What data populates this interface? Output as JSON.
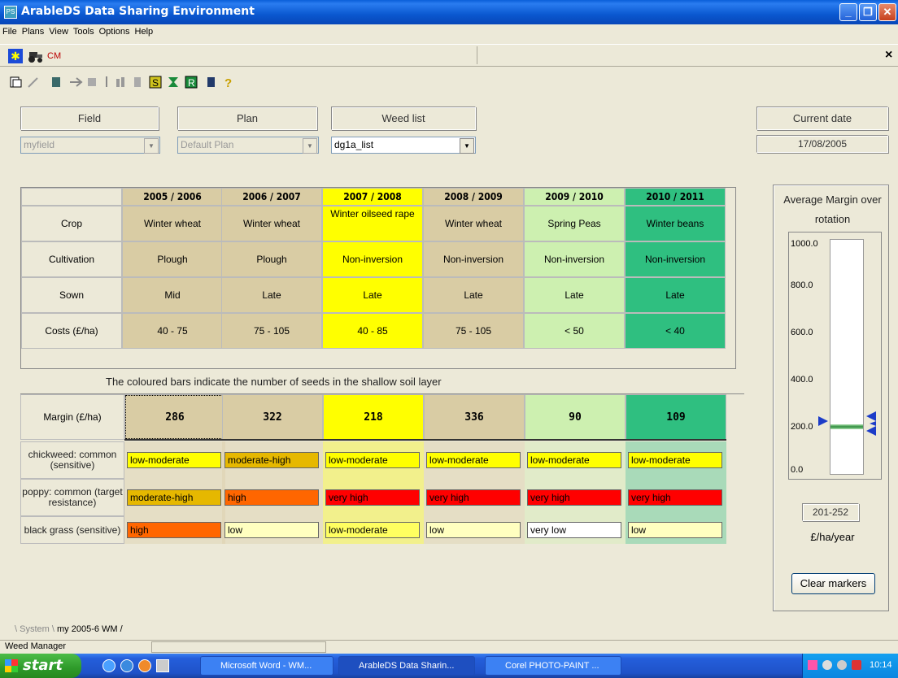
{
  "window": {
    "title": "ArableDS Data Sharing Environment",
    "icon_text": "PS"
  },
  "menu": [
    "File",
    "Plans",
    "View",
    "Tools",
    "Options",
    "Help"
  ],
  "cm_label": "CM",
  "close_x": "×",
  "fields": {
    "field": {
      "label": "Field",
      "value": "myfield"
    },
    "plan": {
      "label": "Plan",
      "value": "Default Plan"
    },
    "weed": {
      "label": "Weed list",
      "value": "dg1a_list"
    },
    "date": {
      "label": "Current date",
      "value": "17/08/2005"
    }
  },
  "plan_table": {
    "years": [
      "2005 / 2006",
      "2006 / 2007",
      "2007 / 2008",
      "2008 / 2009",
      "2009 / 2010",
      "2010 / 2011"
    ],
    "row_labels": [
      "Crop",
      "Cultivation",
      "Sown",
      "Costs  (£/ha)"
    ],
    "crop": [
      "Winter wheat",
      "Winter wheat",
      "Winter oilseed rape",
      "Winter wheat",
      "Spring Peas",
      "Winter beans"
    ],
    "cultivation": [
      "Plough",
      "Plough",
      "Non-inversion",
      "Non-inversion",
      "Non-inversion",
      "Non-inversion"
    ],
    "sown": [
      "Mid",
      "Late",
      "Late",
      "Late",
      "Late",
      "Late"
    ],
    "costs": [
      "40 - 75",
      "75 - 105",
      "40 - 85",
      "75 - 105",
      "< 50",
      "< 40"
    ]
  },
  "seed_caption": "The coloured bars indicate the number of seeds in the shallow soil layer",
  "margin": {
    "label": "Margin (£/ha)",
    "values": [
      "286",
      "322",
      "218",
      "336",
      "90",
      "109"
    ]
  },
  "weeds": [
    {
      "name": "chickweed: common (sensitive)",
      "levels": [
        "low-moderate",
        "moderate-high",
        "low-moderate",
        "low-moderate",
        "low-moderate",
        "low-moderate"
      ],
      "colors": [
        "#ffff00",
        "#e6b800",
        "#ffff00",
        "#ffff00",
        "#ffff00",
        "#ffff00"
      ]
    },
    {
      "name": "poppy: common (target resistance)",
      "levels": [
        "moderate-high",
        "high",
        "very high",
        "very high",
        "very high",
        "very high"
      ],
      "colors": [
        "#e6b800",
        "#ff6600",
        "#ff0000",
        "#ff0000",
        "#ff0000",
        "#ff0000"
      ]
    },
    {
      "name": "black grass (sensitive)",
      "levels": [
        "high",
        "low",
        "low-moderate",
        "low",
        "very low",
        "low"
      ],
      "colors": [
        "#ff6600",
        "#ffffc0",
        "#ffff60",
        "#ffffc0",
        "#ffffff",
        "#ffffc0"
      ]
    }
  ],
  "avg_margin": {
    "title": "Average Margin over rotation",
    "ticks": [
      "1000.0",
      "800.0",
      "600.0",
      "400.0",
      "200.0",
      "0.0"
    ],
    "range_value": "201-252",
    "unit": "£/ha/year",
    "clear_button": "Clear markers",
    "range_low": 201,
    "range_high": 252,
    "max": 1000
  },
  "tabs": [
    "System",
    "my 2005-6 WM"
  ],
  "status": "Weed Manager",
  "taskbar": {
    "start": "start",
    "tasks": [
      "Microsoft Word - WM...",
      "ArableDS Data Sharin...",
      "Corel PHOTO-PAINT ..."
    ],
    "clock": "10:14"
  }
}
